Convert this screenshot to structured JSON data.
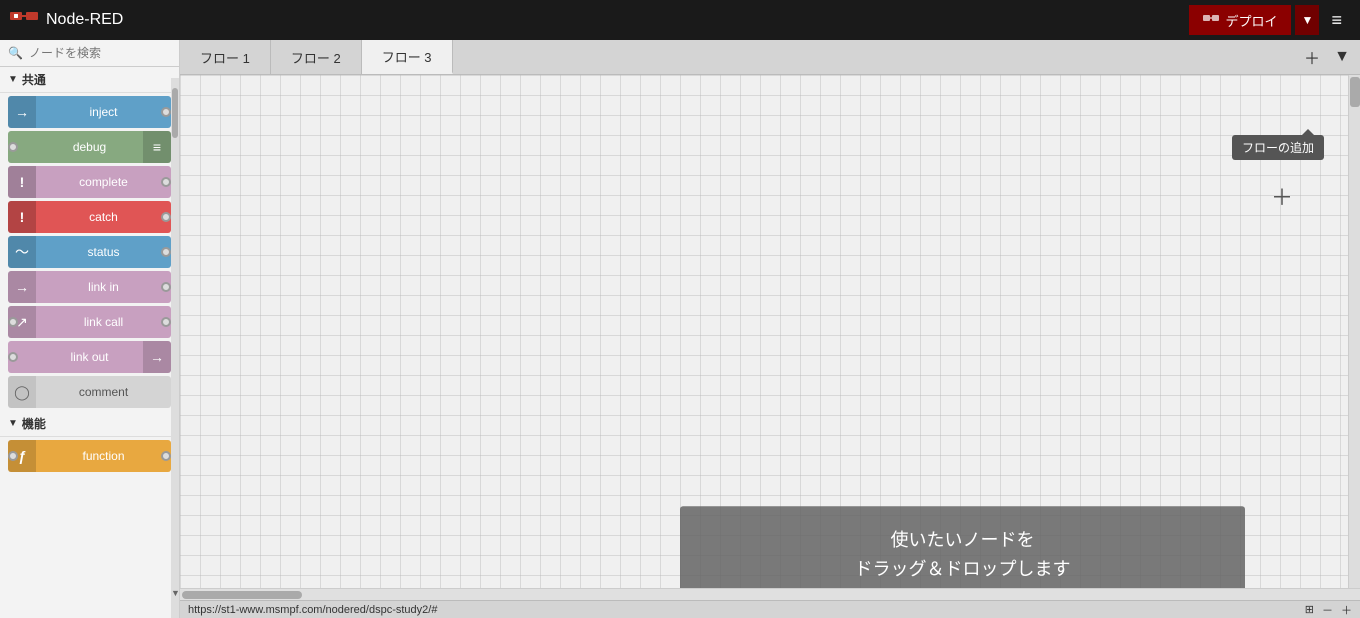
{
  "header": {
    "title": "Node-RED",
    "deploy_label": "デプロイ",
    "menu_icon": "≡"
  },
  "sidebar": {
    "search_placeholder": "ノードを検索",
    "sections": [
      {
        "name": "共通",
        "nodes": [
          {
            "id": "inject",
            "label": "inject",
            "color": "#5fa0c8",
            "icon": "→",
            "has_left_port": false,
            "has_right_port": true
          },
          {
            "id": "debug",
            "label": "debug",
            "color": "#87a980",
            "icon": "≡",
            "icon_side": "right",
            "has_left_port": true,
            "has_right_port": false
          },
          {
            "id": "complete",
            "label": "complete",
            "color": "#c8a0c0",
            "icon": "!",
            "has_left_port": false,
            "has_right_port": true
          },
          {
            "id": "catch",
            "label": "catch",
            "color": "#e05555",
            "icon": "!",
            "has_left_port": false,
            "has_right_port": true
          },
          {
            "id": "status",
            "label": "status",
            "color": "#5fa0c8",
            "icon": "~",
            "has_left_port": false,
            "has_right_port": true
          },
          {
            "id": "link-in",
            "label": "link in",
            "color": "#c8a0c0",
            "icon": "→",
            "has_left_port": false,
            "has_right_port": true
          },
          {
            "id": "link-call",
            "label": "link call",
            "color": "#c8a0c0",
            "icon": "↗",
            "has_left_port": true,
            "has_right_port": true
          },
          {
            "id": "link-out",
            "label": "link out",
            "color": "#c8a0c0",
            "icon": "→",
            "has_left_port": true,
            "has_right_port": false
          },
          {
            "id": "comment",
            "label": "comment",
            "color": "#d4d4d4",
            "text_color": "#555",
            "icon": "◯",
            "has_left_port": false,
            "has_right_port": false
          }
        ]
      },
      {
        "name": "機能",
        "nodes": [
          {
            "id": "function",
            "label": "function",
            "color": "#e8a840",
            "icon": "ƒ",
            "has_left_port": true,
            "has_right_port": true
          }
        ]
      }
    ]
  },
  "tabs": [
    {
      "id": "flow1",
      "label": "フロー 1",
      "active": false
    },
    {
      "id": "flow2",
      "label": "フロー 2",
      "active": false
    },
    {
      "id": "flow3",
      "label": "フロー 3",
      "active": true
    }
  ],
  "canvas": {
    "drag_hint_line1": "使いたいノードを",
    "drag_hint_line2": "ドラッグ＆ドロップします"
  },
  "tooltip": {
    "add_flow": "フローの追加"
  },
  "statusbar": {
    "url": "https://st1-www.msmpf.com/nodered/dspc-study2/#"
  }
}
